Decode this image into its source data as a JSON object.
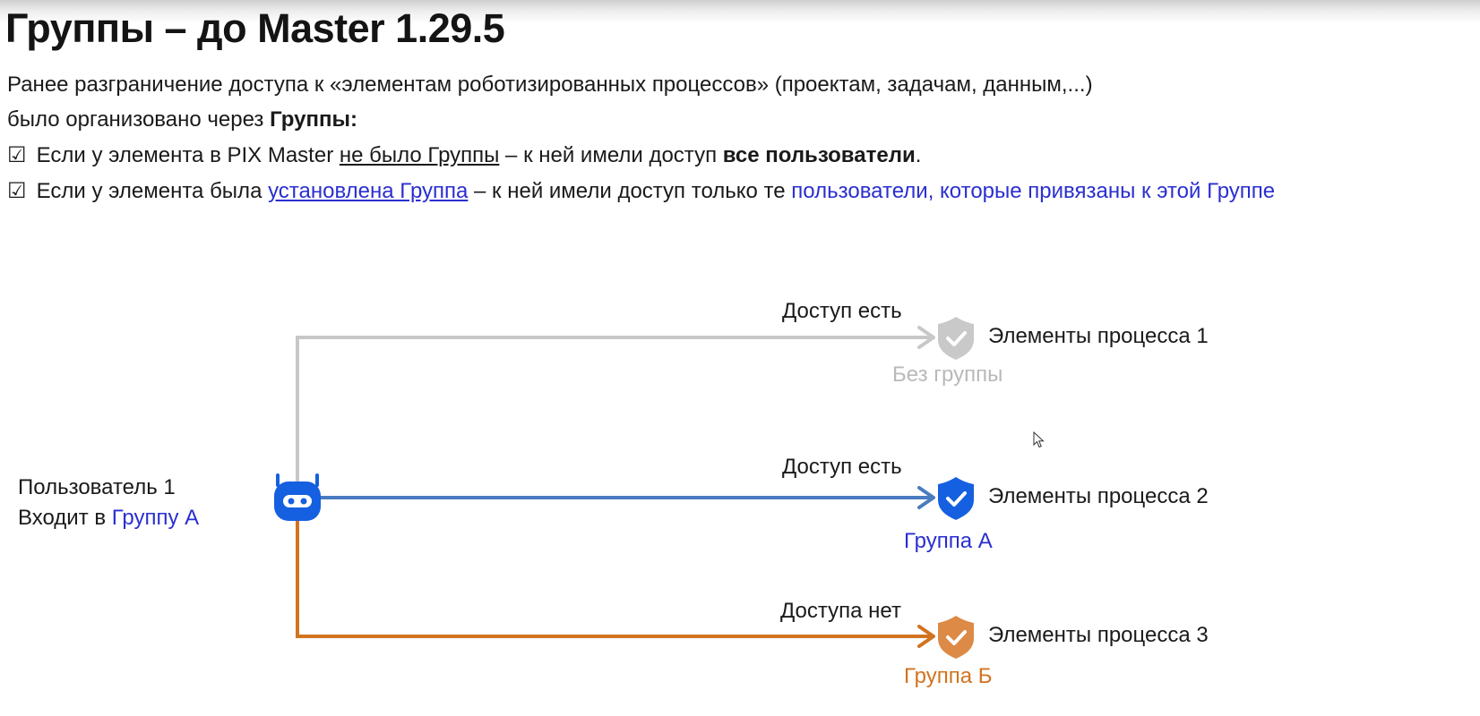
{
  "title": "Группы – до Master 1.29.5",
  "intro": {
    "line1": "Ранее разграничение доступа к «элементам роботизированных процессов» (проектам, задачам, данным,...)",
    "line2_start": "было организовано через ",
    "line2_bold": "Группы:"
  },
  "rule1": {
    "check": "☑",
    "start": " Если у элемента в PIX Master ",
    "underlined": "не было Группы",
    "middle": " – к ней имели доступ ",
    "bold": "все пользователи",
    "end": "."
  },
  "rule2": {
    "check": "☑",
    "start": " Если у элемента была ",
    "link": "установлена Группа",
    "middle": " – к ней имели доступ только те ",
    "colored": "пользователи, которые привязаны к этой Группе"
  },
  "user": {
    "line1": "Пользователь 1",
    "line2_start": "Входит в ",
    "line2_group": "Группу А",
    "icon": "robot-icon"
  },
  "branches": [
    {
      "access": "Доступ есть",
      "target": "Элементы процесса 1",
      "group": "Без группы",
      "color": "#c8c8c8",
      "group_color": "#b9b9b9",
      "icon": "shield-check-icon"
    },
    {
      "access": "Доступ есть",
      "target": "Элементы процесса 2",
      "group": "Группа А",
      "color": "#4a7cc0",
      "group_color": "#2a2fd0",
      "icon": "shield-check-icon"
    },
    {
      "access": "Доступа нет",
      "target": "Элементы процесса 3",
      "group": "Группа Б",
      "color": "#d2731f",
      "group_color": "#d2731f",
      "icon": "shield-check-icon"
    }
  ],
  "colors": {
    "accent_blue": "#2a2fd0",
    "robot_blue": "#1560e0",
    "shield_gray": "#c9c9c9",
    "shield_blue": "#1560e0",
    "shield_orange": "#dc8a46"
  }
}
